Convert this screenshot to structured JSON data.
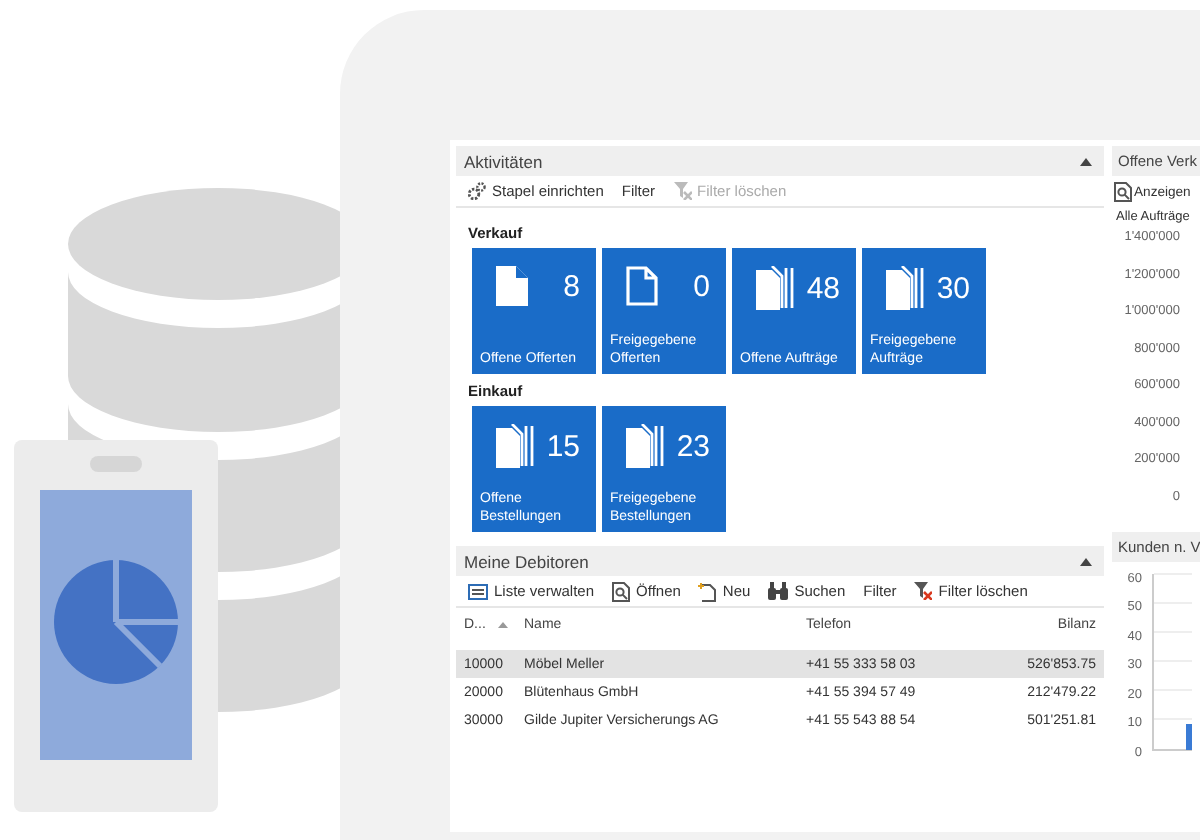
{
  "activities": {
    "title": "Aktivitäten",
    "toolbar": [
      {
        "kind": "setup",
        "label": "Stapel einrichten",
        "disabled": false
      },
      {
        "kind": "plain",
        "label": "Filter",
        "disabled": false
      },
      {
        "kind": "clear",
        "label": "Filter löschen",
        "disabled": true
      }
    ],
    "groups": [
      {
        "title": "Verkauf",
        "tiles": [
          {
            "kind": "doc",
            "count": "8",
            "label": "Offene Offerten"
          },
          {
            "kind": "outline",
            "count": "0",
            "label": "Freigegebene Offerten"
          },
          {
            "kind": "stack",
            "count": "48",
            "label": "Offene Aufträge"
          },
          {
            "kind": "stack",
            "count": "30",
            "label": "Freigegebene Aufträge"
          }
        ]
      },
      {
        "title": "Einkauf",
        "tiles": [
          {
            "kind": "stack",
            "count": "15",
            "label": "Offene Bestellungen"
          },
          {
            "kind": "stack",
            "count": "23",
            "label": "Freigegebene Bestellungen"
          }
        ]
      }
    ]
  },
  "debtors": {
    "title": "Meine Debitoren",
    "toolbar": [
      {
        "kind": "manage",
        "label": "Liste verwalten",
        "disabled": false
      },
      {
        "kind": "open",
        "label": "Öffnen",
        "disabled": false
      },
      {
        "kind": "new",
        "label": "Neu",
        "disabled": false
      },
      {
        "kind": "search",
        "label": "Suchen",
        "disabled": false
      },
      {
        "kind": "plain",
        "label": "Filter",
        "disabled": false
      },
      {
        "kind": "clear",
        "label": "Filter löschen",
        "disabled": false
      }
    ],
    "columns": [
      "D...",
      "Name",
      "Telefon",
      "Bilanz"
    ],
    "rows": [
      {
        "cells": [
          "10000",
          "Möbel Meller",
          "+41 55 333 58 03",
          "526'853.75"
        ],
        "selected": true
      },
      {
        "cells": [
          "20000",
          "Blütenhaus GmbH",
          "+41 55 394 57 49",
          "212'479.22"
        ],
        "selected": false
      },
      {
        "cells": [
          "30000",
          "Gilde Jupiter Versicherungs AG",
          "+41 55 543 88 54",
          "501'251.81"
        ],
        "selected": false
      }
    ]
  },
  "sales_panel": {
    "title": "Offene Verk",
    "action": "Anzeigen",
    "subtitle": "Alle Aufträge",
    "axis_labels": [
      "1'400'000",
      "1'200'000",
      "1'000'000",
      "800'000",
      "600'000",
      "400'000",
      "200'000",
      "0"
    ]
  },
  "customers_panel": {
    "title": "Kunden n. V",
    "axis_labels": [
      "60",
      "50",
      "40",
      "30",
      "20",
      "10",
      "0"
    ]
  }
}
